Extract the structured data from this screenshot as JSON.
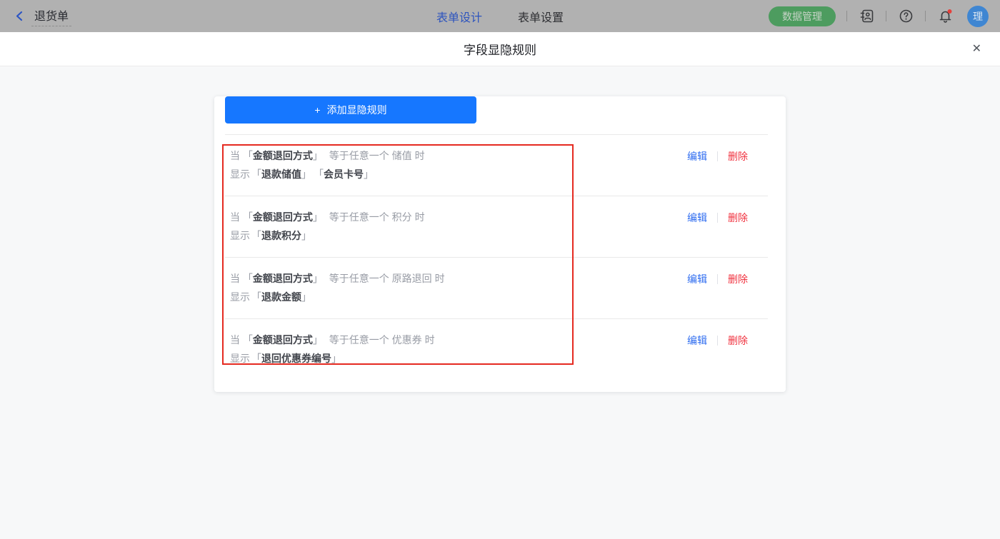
{
  "ui": {
    "bracket_open": "「",
    "bracket_close": "」"
  },
  "header": {
    "back_title": "退货单",
    "tabs": [
      {
        "label": "表单设计",
        "active": true
      },
      {
        "label": "表单设置",
        "active": false
      }
    ],
    "data_manage_button": "数据管理",
    "avatar_initial": "理",
    "icon_names": [
      "back-chevron-icon",
      "contacts-icon",
      "help-icon",
      "notification-bell-icon"
    ],
    "notification_has_unread": true
  },
  "modal": {
    "title": "字段显隐规则",
    "close_icon": "✕",
    "add_rule_button": {
      "plus": "+",
      "label": "添加显隐规则"
    },
    "actions": {
      "edit": "编辑",
      "delete": "删除"
    },
    "rules": [
      {
        "prefix": "当",
        "field": "金额退回方式",
        "operator": "等于任意一个",
        "value": "储值",
        "suffix": "时",
        "action": "显示",
        "targets": [
          "退款储值",
          "会员卡号"
        ]
      },
      {
        "prefix": "当",
        "field": "金额退回方式",
        "operator": "等于任意一个",
        "value": "积分",
        "suffix": "时",
        "action": "显示",
        "targets": [
          "退款积分"
        ]
      },
      {
        "prefix": "当",
        "field": "金额退回方式",
        "operator": "等于任意一个",
        "value": "原路退回",
        "suffix": "时",
        "action": "显示",
        "targets": [
          "退款金额"
        ]
      },
      {
        "prefix": "当",
        "field": "金额退回方式",
        "operator": "等于任意一个",
        "value": "优惠券",
        "suffix": "时",
        "action": "显示",
        "targets": [
          "退回优惠券编号"
        ]
      }
    ]
  },
  "colors": {
    "primary_blue": "#1677ff",
    "edit_blue": "#2e6cf0",
    "delete_red": "#f0323f",
    "annotation_red": "#e52a20",
    "header_green": "#4d9c5f",
    "avatar_blue": "#3f86d2",
    "dimmed_header_bg": "#b1b1b1"
  }
}
